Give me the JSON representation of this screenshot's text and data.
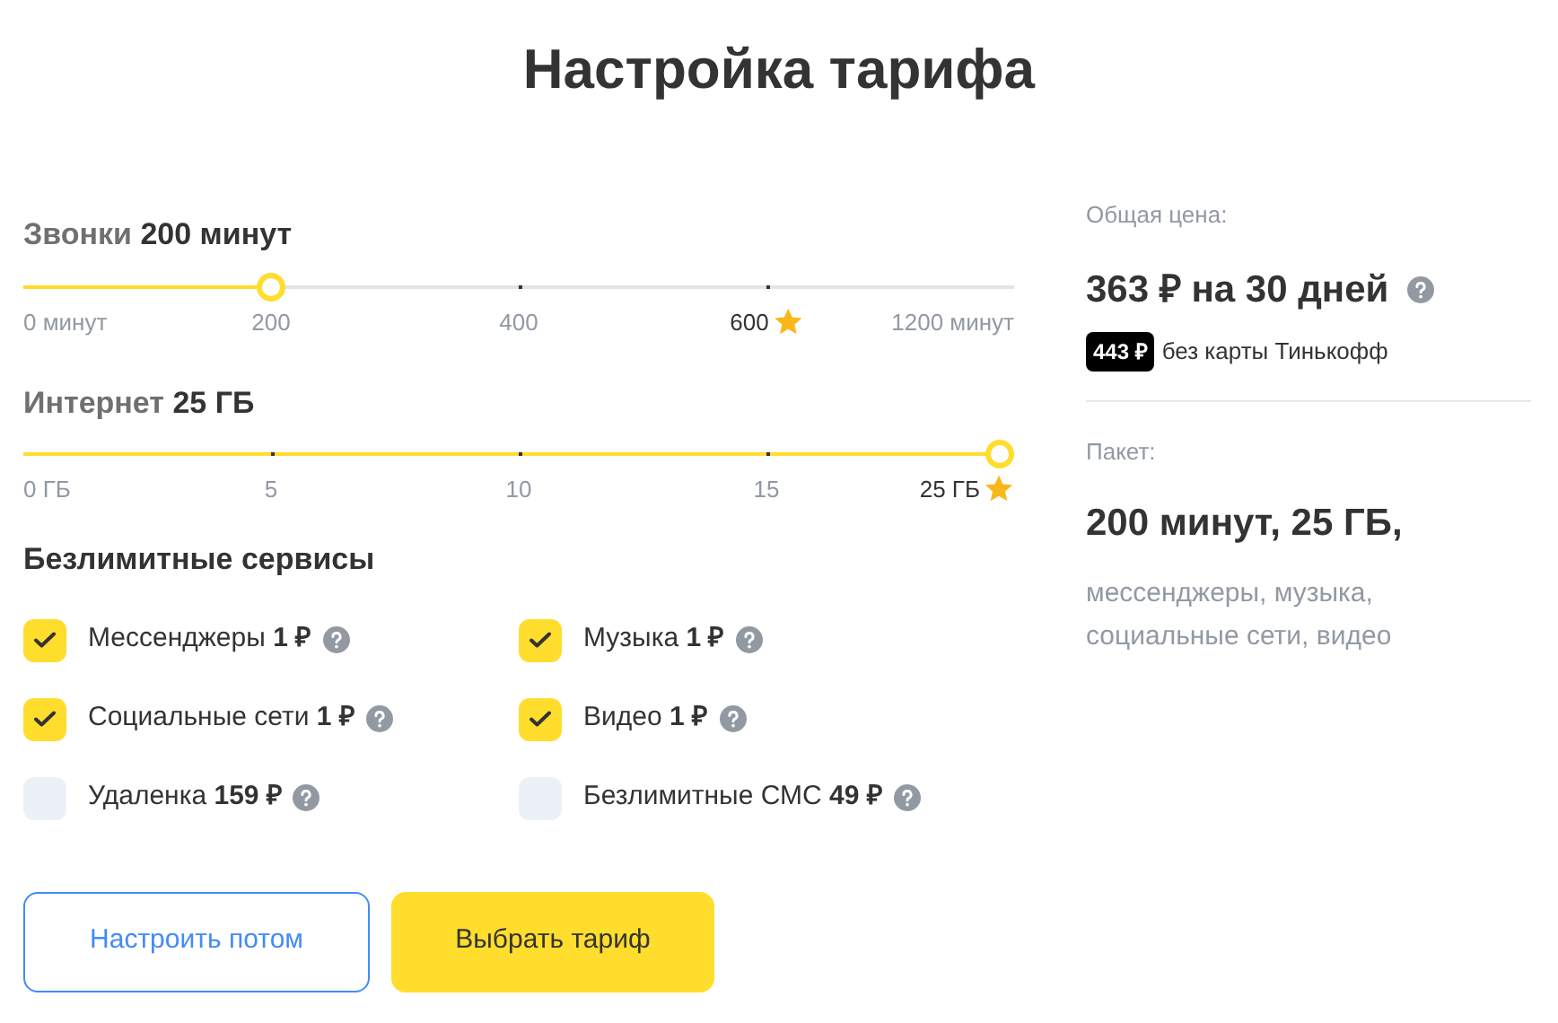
{
  "title": "Настройка тарифа",
  "sliders": [
    {
      "label": "Звонки **200 минут**",
      "level": 0.25,
      "ticks": [
        {
          "label": "0 минут",
          "starred": false
        },
        {
          "label": "200",
          "starred": false
        },
        {
          "label": "400",
          "starred": false
        },
        {
          "label": "600",
          "starred": true
        },
        {
          "label": "1200 минут",
          "starred": false
        }
      ]
    },
    {
      "label": "Интернет **25 ГБ**",
      "level": 1,
      "ticks": [
        {
          "label": "0 ГБ",
          "starred": false
        },
        {
          "label": "5",
          "starred": false
        },
        {
          "label": "10",
          "starred": false
        },
        {
          "label": "15",
          "starred": false
        },
        {
          "label": "25 ГБ",
          "starred": true
        }
      ]
    }
  ],
  "services_title": "Безлимитные сервисы",
  "services": [
    {
      "label": "Мессенджеры **1 ₽**",
      "checked": true
    },
    {
      "label": "Музыка **1 ₽**",
      "checked": true
    },
    {
      "label": "Социальные сети **1 ₽**",
      "checked": true
    },
    {
      "label": "Видео **1 ₽**",
      "checked": true
    },
    {
      "label": "Удаленка **159 ₽**",
      "checked": false
    },
    {
      "label": "Безлимитные СМС **49 ₽**",
      "checked": false
    }
  ],
  "buttons": [
    {
      "label": "Настроить потом",
      "kind": "outline"
    },
    {
      "label": "Выбрать тариф",
      "kind": "primary"
    }
  ],
  "summary": {
    "price_label": "Общая цена:",
    "price": "363 ₽ на 30 дней",
    "alt_price": "443 ₽",
    "alt_note": "без карты Тинькофф",
    "package_label": "Пакет:",
    "package": "200 минут, 25 ГБ,",
    "package_details": "мессенджеры, музыка, социальные сети, видео"
  }
}
